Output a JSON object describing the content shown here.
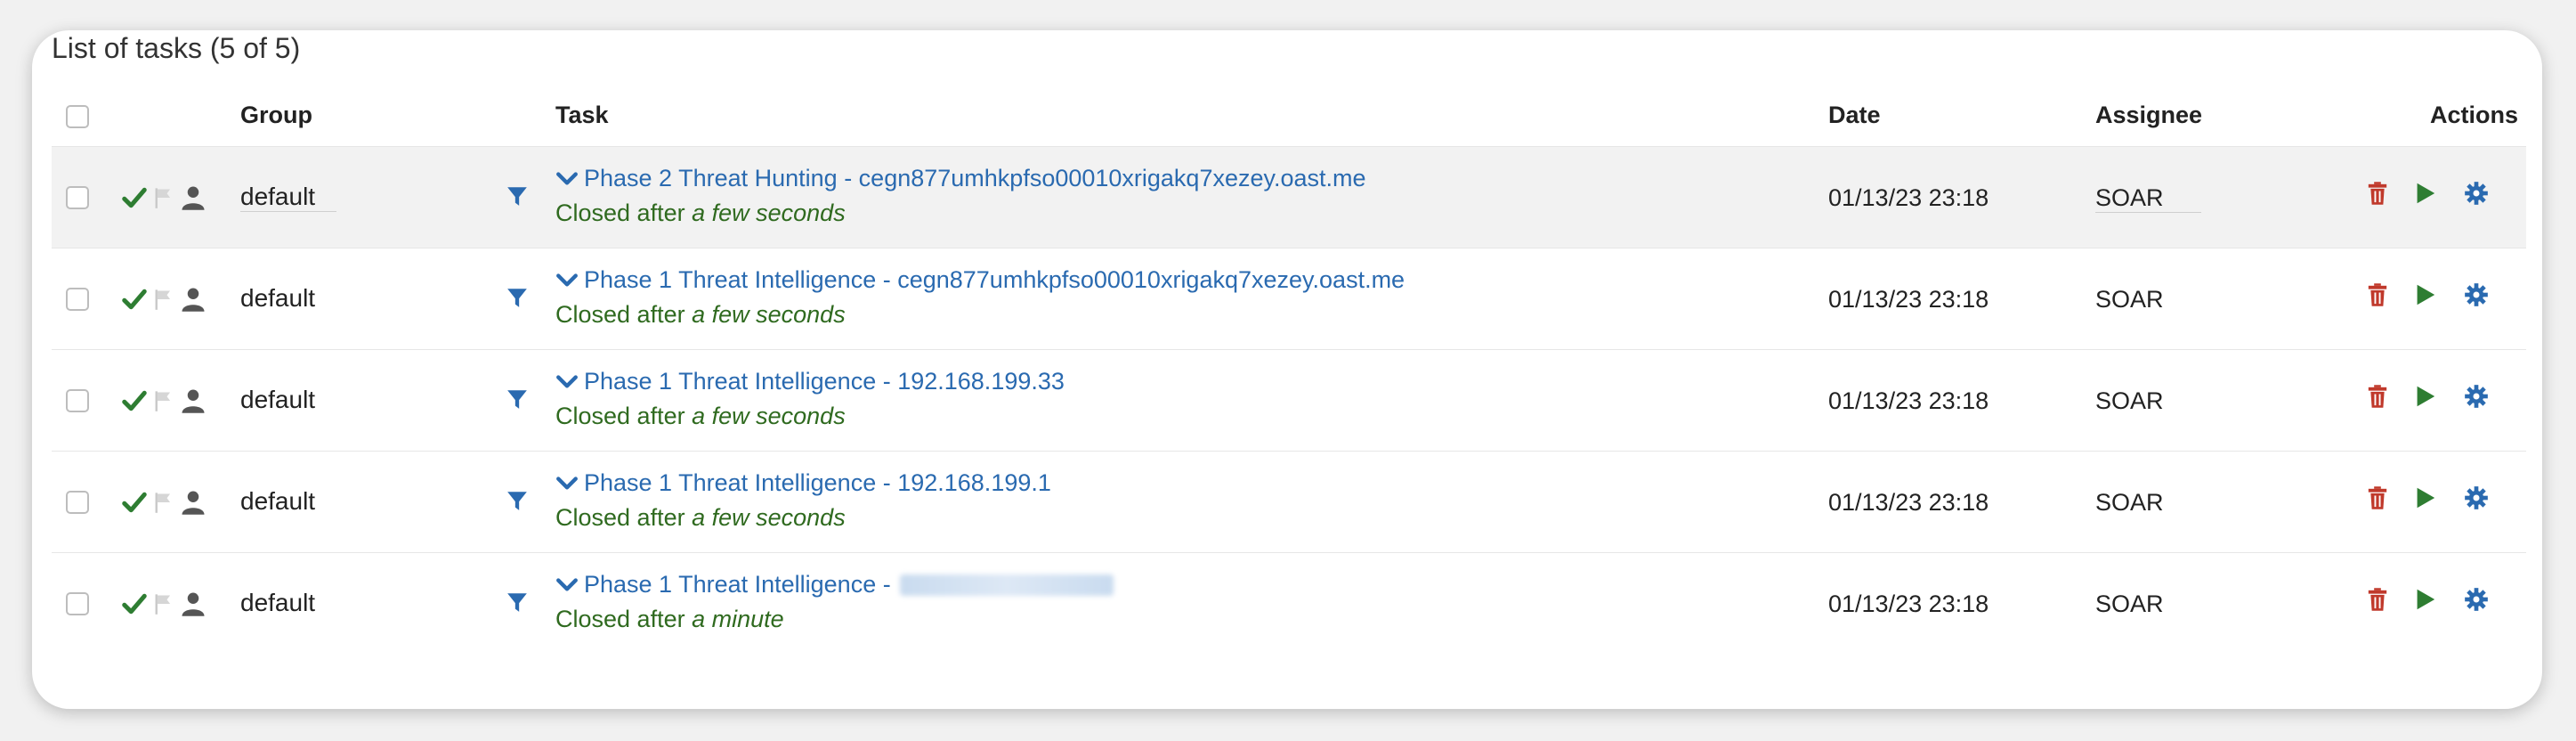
{
  "list_title": "List of tasks  (5 of 5)",
  "columns": {
    "group": "Group",
    "task": "Task",
    "date": "Date",
    "assignee": "Assignee",
    "actions": "Actions"
  },
  "colors": {
    "link": "#2a6ab0",
    "status_green": "#2f6a1f",
    "check_green": "#2e7d32",
    "delete_red": "#c0392b",
    "settings_blue": "#2a6ab0",
    "row_highlight": "#f2f2f2"
  },
  "tasks": [
    {
      "group": "default",
      "title": "Phase 2 Threat Hunting - cegn877umhkpfso00010xrigakq7xezey.oast.me",
      "status_prefix": "Closed after",
      "status_duration": "a few seconds",
      "date": "01/13/23 23:18",
      "assignee": "SOAR"
    },
    {
      "group": "default",
      "title": "Phase 1 Threat Intelligence - cegn877umhkpfso00010xrigakq7xezey.oast.me",
      "status_prefix": "Closed after",
      "status_duration": "a few seconds",
      "date": "01/13/23 23:18",
      "assignee": "SOAR"
    },
    {
      "group": "default",
      "title": "Phase 1 Threat Intelligence - 192.168.199.33",
      "status_prefix": "Closed after",
      "status_duration": "a few seconds",
      "date": "01/13/23 23:18",
      "assignee": "SOAR"
    },
    {
      "group": "default",
      "title": "Phase 1 Threat Intelligence - 192.168.199.1",
      "status_prefix": "Closed after",
      "status_duration": "a few seconds",
      "date": "01/13/23 23:18",
      "assignee": "SOAR"
    },
    {
      "group": "default",
      "title": "Phase 1 Threat Intelligence -",
      "status_prefix": "Closed after",
      "status_duration": "a minute",
      "date": "01/13/23 23:18",
      "assignee": "SOAR"
    }
  ],
  "icons": {
    "status": "check-icon",
    "flag": "flag-icon",
    "user": "user-icon",
    "filter": "filter-icon",
    "expand": "chevron-down-icon",
    "delete": "trash-icon",
    "run": "play-icon",
    "settings": "gear-icon"
  }
}
